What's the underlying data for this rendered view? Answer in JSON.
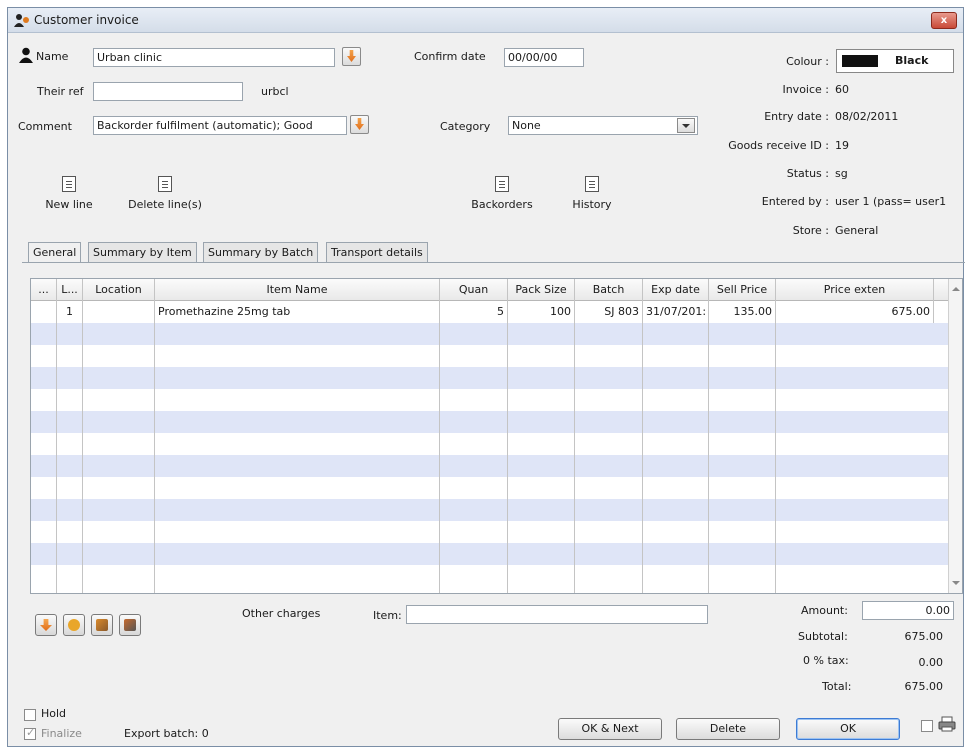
{
  "window": {
    "title": "Customer invoice",
    "close_label": "x"
  },
  "header": {
    "name_label": "Name",
    "name_value": "Urban clinic",
    "their_ref_label": "Their ref",
    "their_ref_value": "",
    "code": "urbcl",
    "comment_label": "Comment",
    "comment_value": "Backorder fulfilment (automatic); Good",
    "confirm_date_label": "Confirm date",
    "confirm_date_value": "00/00/00",
    "category_label": "Category",
    "category_value": "None"
  },
  "info": {
    "colour_label": "Colour :",
    "colour_value": "Black",
    "colour_hex": "#111111",
    "invoice_label": "Invoice :",
    "invoice_value": "60",
    "entry_date_label": "Entry date :",
    "entry_date_value": "08/02/2011",
    "goods_receive_label": "Goods receive ID :",
    "goods_receive_value": "19",
    "status_label": "Status :",
    "status_value": "sg",
    "entered_by_label": "Entered by :",
    "entered_by_value": "user 1 (pass= user1",
    "store_label": "Store :",
    "store_value": "General"
  },
  "toolbar": {
    "new_line": "New line",
    "delete_lines": "Delete line(s)",
    "backorders": "Backorders",
    "history": "History"
  },
  "tabs": [
    "General",
    "Summary by Item",
    "Summary by Batch",
    "Transport details"
  ],
  "table": {
    "columns": [
      "...",
      "L...",
      "Location",
      "Item Name",
      "Quan",
      "Pack Size",
      "Batch",
      "Exp date",
      "Sell Price",
      "Price exten"
    ],
    "rows": [
      {
        "dots": "",
        "line": "1",
        "location": "",
        "item": "Promethazine 25mg tab",
        "quan": "5",
        "pack": "100",
        "batch": "SJ 803",
        "exp": "31/07/201:",
        "sell": "135.00",
        "ext": "675.00"
      }
    ]
  },
  "charges": {
    "other_charges_label": "Other charges",
    "item_label": "Item:",
    "item_value": ""
  },
  "totals": {
    "amount_label": "Amount:",
    "amount_value": "0.00",
    "subtotal_label": "Subtotal:",
    "subtotal_value": "675.00",
    "tax_label": "0 % tax:",
    "tax_value": "0.00",
    "total_label": "Total:",
    "total_value": "675.00"
  },
  "footer": {
    "hold_label": "Hold",
    "finalize_label": "Finalize",
    "export_batch": "Export batch: 0",
    "ok_next": "OK & Next",
    "delete": "Delete",
    "ok": "OK"
  }
}
